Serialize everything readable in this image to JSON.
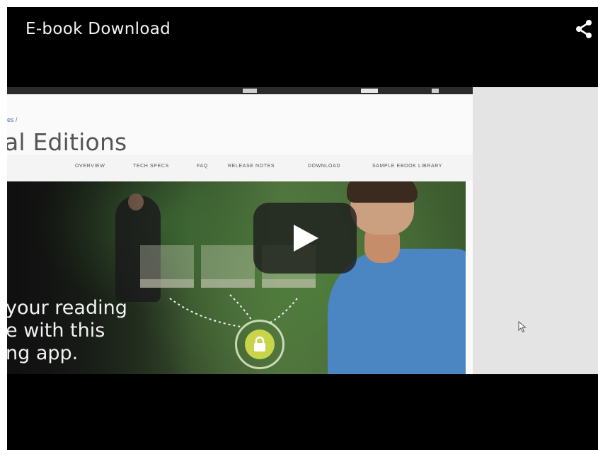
{
  "video": {
    "title": "E-book Download",
    "icons": {
      "share": "share-icon",
      "play": "play-icon",
      "cursor": "mouse-pointer-icon"
    }
  },
  "frame": {
    "breadcrumb": "es /",
    "product_title": "al Editions",
    "nav": [
      "OVERVIEW",
      "TECH SPECS",
      "FAQ",
      "RELEASE NOTES",
      "DOWNLOAD",
      "SAMPLE EBOOK LIBRARY"
    ],
    "hero_lines": [
      "your reading",
      "e with this",
      "ng app."
    ]
  },
  "colors": {
    "background": "#000000",
    "title_text": "#f2f2f2",
    "hero_green": "#4f7d3d",
    "shirt_blue": "#4b86c2",
    "lock_yellow": "#c9d44a"
  }
}
